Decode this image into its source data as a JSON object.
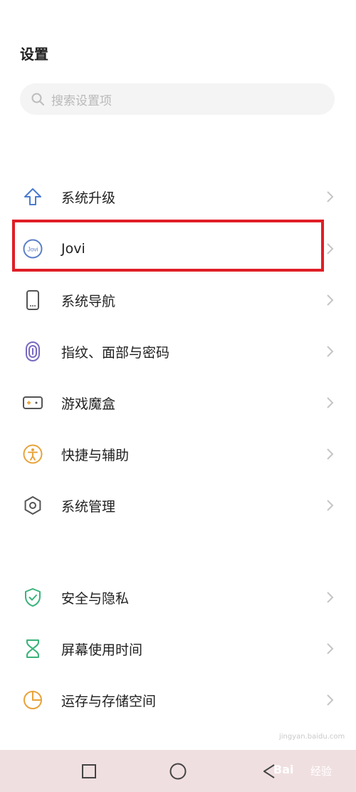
{
  "header": {
    "title": "设置"
  },
  "search": {
    "placeholder": "搜索设置项",
    "icon": "search-icon"
  },
  "menu": {
    "items": [
      {
        "label": "系统升级",
        "icon": "arrow-up-icon"
      },
      {
        "label": "Jovi",
        "icon": "jovi-icon",
        "icon_text": "Jovi"
      },
      {
        "label": "系统导航",
        "icon": "phone-navigation-icon"
      },
      {
        "label": "指纹、面部与密码",
        "icon": "fingerprint-icon"
      },
      {
        "label": "游戏魔盒",
        "icon": "game-box-icon"
      },
      {
        "label": "快捷与辅助",
        "icon": "accessibility-icon"
      },
      {
        "label": "系统管理",
        "icon": "hexagon-settings-icon"
      },
      {
        "label": "安全与隐私",
        "icon": "shield-check-icon"
      },
      {
        "label": "屏幕使用时间",
        "icon": "hourglass-icon"
      },
      {
        "label": "运存与存储空间",
        "icon": "pie-chart-icon"
      }
    ]
  },
  "watermark": {
    "brand": "Bai",
    "suffix": "经验",
    "url": "jingyan.baidu.com"
  },
  "colors": {
    "highlight": "#e01e26",
    "blue_icon": "#4a7bd0",
    "orange_icon": "#e8a33a",
    "green_icon": "#3bb37a"
  }
}
